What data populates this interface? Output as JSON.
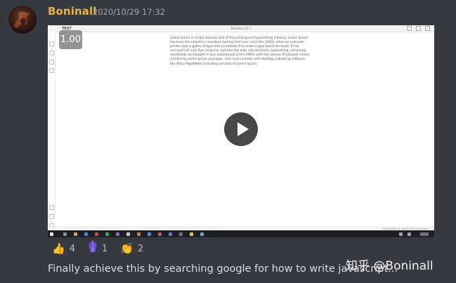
{
  "message": {
    "username": "Boninall",
    "timestamp": "2020/10/29 17:32",
    "text": "Finally achieve this by searching google for how to write javascript..."
  },
  "video": {
    "app_title": "Obsidian 0.9.7",
    "tab_label": "TEST",
    "playback_speed": "1.00",
    "document_text": "Lorem Ipsum is simply dummy text of the printing and typesetting industry. Lorem Ipsum has been the industry's standard dummy text ever since the 1500s, when an unknown printer took a galley of type and scrambled it to make a type specimen book. It has survived not only five centuries, but also the leap into electronic typesetting, remaining essentially unchanged. It was popularised in the 1960s with the release of Letraset sheets containing Lorem Ipsum passages, and more recently with desktop publishing software like Aldus PageMaker including versions of Lorem Ipsum.",
    "status_info": "0 backlinks   91 words   578 characters"
  },
  "reactions": [
    {
      "icon": "thumbs-up-icon",
      "emoji": "👍",
      "count": "4"
    },
    {
      "icon": "obsidian-crystal-icon",
      "emoji": "💎",
      "count": "1"
    },
    {
      "icon": "clapping-hands-icon",
      "emoji": "👏",
      "count": "2"
    }
  ],
  "watermark": "知乎 @Boninall",
  "colors": {
    "background": "#36393f",
    "username": "#e8b04b",
    "timestamp": "#a3a6aa",
    "text": "#dcddde"
  }
}
